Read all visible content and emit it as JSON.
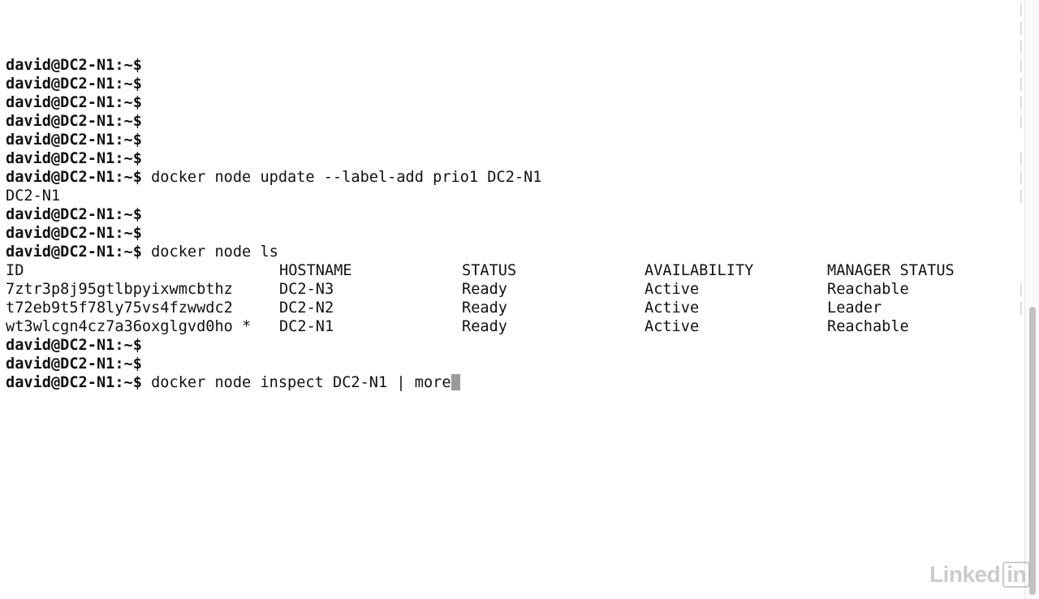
{
  "terminal": {
    "prompt": "david@DC2-N1:~$",
    "lines": [
      {
        "type": "prompt",
        "cmd": ""
      },
      {
        "type": "prompt",
        "cmd": ""
      },
      {
        "type": "prompt",
        "cmd": ""
      },
      {
        "type": "prompt",
        "cmd": ""
      },
      {
        "type": "prompt",
        "cmd": ""
      },
      {
        "type": "prompt",
        "cmd": ""
      },
      {
        "type": "prompt",
        "cmd": " docker node update --label-add prio1 DC2-N1"
      },
      {
        "type": "output",
        "text": "DC2-N1"
      },
      {
        "type": "prompt",
        "cmd": ""
      },
      {
        "type": "prompt",
        "cmd": ""
      },
      {
        "type": "prompt",
        "cmd": " docker node ls"
      }
    ],
    "table": {
      "headers": [
        "ID",
        "HOSTNAME",
        "STATUS",
        "AVAILABILITY",
        "MANAGER STATUS"
      ],
      "rows": [
        [
          "7ztr3p8j95gtlbpyixwmcbthz",
          "DC2-N3",
          "Ready",
          "Active",
          "Reachable"
        ],
        [
          "t72eb9t5f78ly75vs4fzwwdc2",
          "DC2-N2",
          "Ready",
          "Active",
          "Leader"
        ],
        [
          "wt3wlcgn4cz7a36oxglgvd0ho *",
          "DC2-N1",
          "Ready",
          "Active",
          "Reachable"
        ]
      ]
    },
    "after_lines": [
      {
        "type": "prompt",
        "cmd": ""
      },
      {
        "type": "prompt",
        "cmd": ""
      }
    ],
    "current_command": " docker node inspect DC2-N1 | more"
  },
  "watermark": {
    "text": "Linked",
    "boxed": "in"
  },
  "colors": {
    "background": "#ffffff",
    "text": "#111111",
    "cursor": "#9a9a9a"
  }
}
